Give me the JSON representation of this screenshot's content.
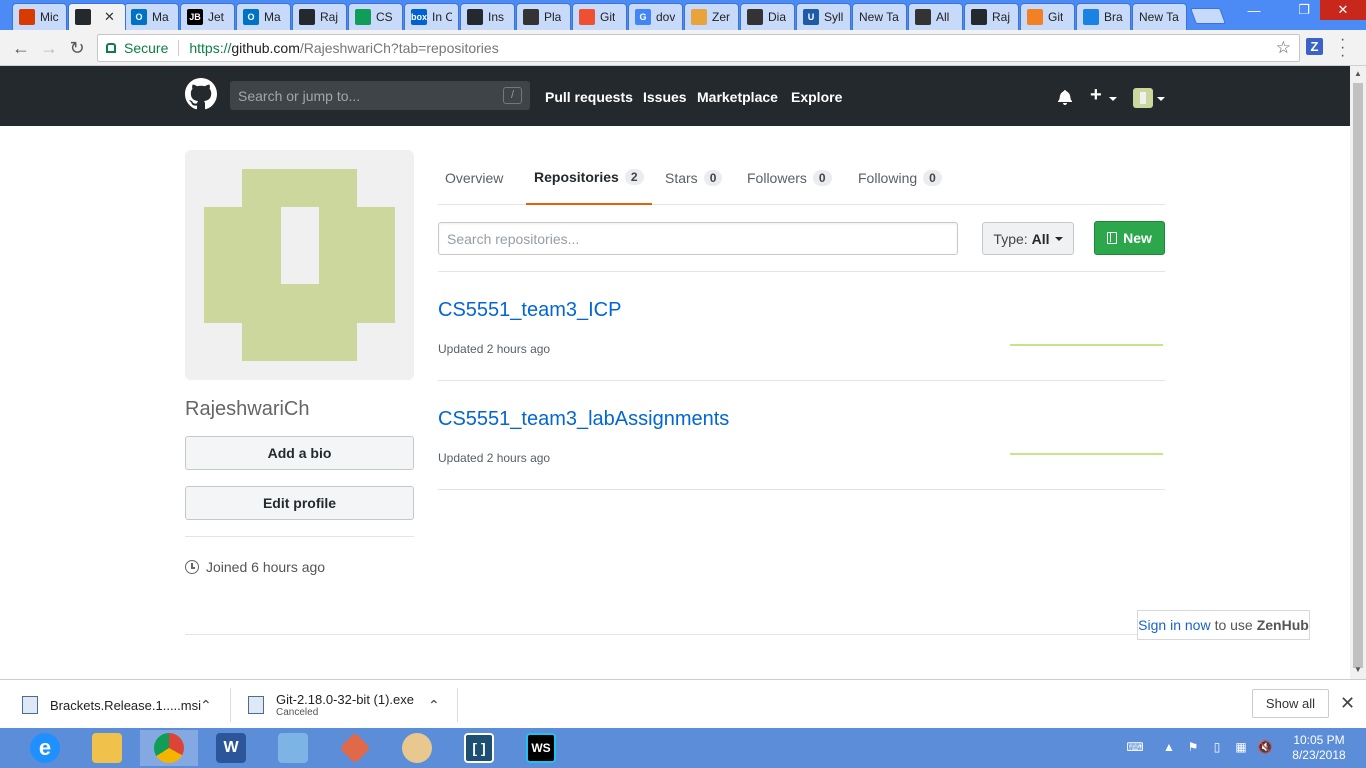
{
  "browser": {
    "tabs": [
      {
        "label": "Mic",
        "fav_color": "#d83b01",
        "fav_text": ""
      },
      {
        "label": "",
        "fav_color": "#24292e",
        "fav_text": "",
        "active": true
      },
      {
        "label": "Ma",
        "fav_color": "#0072c6",
        "fav_text": "O"
      },
      {
        "label": "Jet",
        "fav_color": "#000000",
        "fav_text": "JB"
      },
      {
        "label": "Ma",
        "fav_color": "#0072c6",
        "fav_text": "O"
      },
      {
        "label": "Raj",
        "fav_color": "#24292e",
        "fav_text": ""
      },
      {
        "label": "CS",
        "fav_color": "#0f9d58",
        "fav_text": ""
      },
      {
        "label": "In C",
        "fav_color": "#0061d5",
        "fav_text": "box"
      },
      {
        "label": "Ins",
        "fav_color": "#24292e",
        "fav_text": ""
      },
      {
        "label": "Pla",
        "fav_color": "#333333",
        "fav_text": ""
      },
      {
        "label": "Git",
        "fav_color": "#f05032",
        "fav_text": ""
      },
      {
        "label": "dov",
        "fav_color": "#4285f4",
        "fav_text": "G"
      },
      {
        "label": "Zer",
        "fav_color": "#e8a33a",
        "fav_text": ""
      },
      {
        "label": "Dia",
        "fav_color": "#333333",
        "fav_text": ""
      },
      {
        "label": "Syll",
        "fav_color": "#1e5aa8",
        "fav_text": "U"
      },
      {
        "label": "New Ta",
        "fav_color": "",
        "fav_text": ""
      },
      {
        "label": "All",
        "fav_color": "#333333",
        "fav_text": ""
      },
      {
        "label": "Raj",
        "fav_color": "#24292e",
        "fav_text": ""
      },
      {
        "label": "Git",
        "fav_color": "#f48024",
        "fav_text": ""
      },
      {
        "label": "Bra",
        "fav_color": "#1a82e2",
        "fav_text": ""
      },
      {
        "label": "New Ta",
        "fav_color": "",
        "fav_text": ""
      }
    ],
    "url_protocol": "https://",
    "url_host": "github.com",
    "url_path": "/RajeshwariCh?tab=repositories",
    "secure_label": "Secure",
    "extension_label": "Z"
  },
  "github_header": {
    "search_placeholder": "Search or jump to...",
    "slash_hint": "/",
    "nav": [
      "Pull requests",
      "Issues",
      "Marketplace",
      "Explore"
    ],
    "plus": "+"
  },
  "profile": {
    "username": "RajeshwariCh",
    "add_bio": "Add a bio",
    "edit_profile": "Edit profile",
    "joined": "Joined 6 hours ago"
  },
  "tabs": [
    {
      "label": "Overview",
      "count": null
    },
    {
      "label": "Repositories",
      "count": "2"
    },
    {
      "label": "Stars",
      "count": "0"
    },
    {
      "label": "Followers",
      "count": "0"
    },
    {
      "label": "Following",
      "count": "0"
    }
  ],
  "repo_controls": {
    "search_placeholder": "Search repositories...",
    "type_label": "Type:",
    "type_value": "All",
    "new_label": "New"
  },
  "repos": [
    {
      "name": "CS5551_team3_ICP",
      "updated": "Updated 2 hours ago"
    },
    {
      "name": "CS5551_team3_labAssignments",
      "updated": "Updated 2 hours ago"
    }
  ],
  "zenhub": {
    "link": "Sign in now",
    "middle": "to use",
    "brand": "ZenHub"
  },
  "downloads": [
    {
      "name": "Brackets.Release.1.....msi",
      "status": ""
    },
    {
      "name": "Git-2.18.0-32-bit (1).exe",
      "status": "Canceled"
    }
  ],
  "show_all": "Show all",
  "taskbar": {
    "time": "10:05 PM",
    "date": "8/23/2018"
  },
  "colors": {
    "github_dark": "#24292e",
    "link_blue": "#0366d6",
    "new_green": "#2ca74b",
    "tab_orange": "#e36209",
    "avatar_green": "#ccd79e"
  }
}
